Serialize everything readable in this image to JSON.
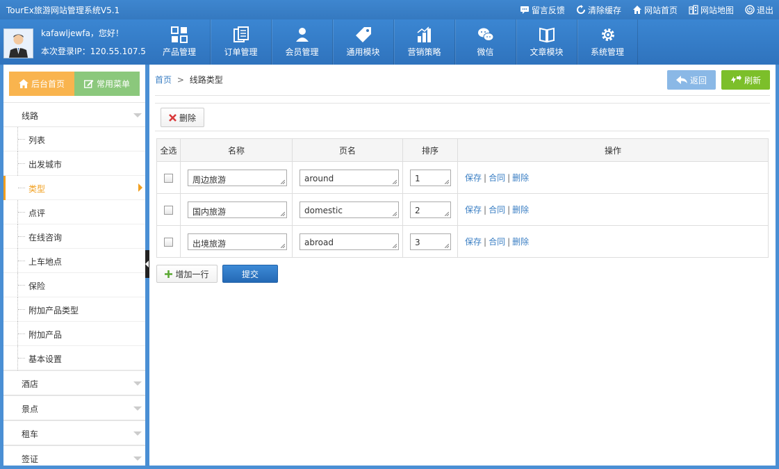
{
  "app": {
    "title": "TourEx旅游网站管理系统V5.1"
  },
  "top_links": [
    {
      "label": "留言反馈",
      "icon": "message-icon"
    },
    {
      "label": "清除缓存",
      "icon": "refresh-cache-icon"
    },
    {
      "label": "网站首页",
      "icon": "home-icon"
    },
    {
      "label": "网站地图",
      "icon": "sitemap-icon"
    },
    {
      "label": "退出",
      "icon": "power-icon"
    }
  ],
  "user": {
    "greeting": "kafawljewfa，您好！",
    "last_login": "本次登录IP：120.55.107.5"
  },
  "nav": [
    {
      "label": "产品管理",
      "icon": "grid-icon"
    },
    {
      "label": "订单管理",
      "icon": "document-icon"
    },
    {
      "label": "会员管理",
      "icon": "user-icon"
    },
    {
      "label": "通用模块",
      "icon": "tag-icon"
    },
    {
      "label": "营销策略",
      "icon": "bar-chart-icon"
    },
    {
      "label": "微信",
      "icon": "wechat-icon"
    },
    {
      "label": "文章模块",
      "icon": "book-icon"
    },
    {
      "label": "系统管理",
      "icon": "gear-icon"
    }
  ],
  "sidebar": {
    "home_button": "后台首页",
    "common_button": "常用菜单",
    "group_route": "线路",
    "items": [
      "列表",
      "出发城市",
      "类型",
      "点评",
      "在线咨询",
      "上车地点",
      "保险",
      "附加产品类型",
      "附加产品",
      "基本设置"
    ],
    "active_index": 2,
    "groups": [
      "酒店",
      "景点",
      "租车",
      "签证"
    ]
  },
  "breadcrumb": {
    "home": "首页",
    "separator": ">",
    "current": "线路类型"
  },
  "toolbar": {
    "back": "返回",
    "refresh": "刷新",
    "delete": "删除"
  },
  "table": {
    "headers": {
      "select_all": "全选",
      "name": "名称",
      "page_name": "页名",
      "sort": "排序",
      "actions": "操作"
    },
    "rows": [
      {
        "name": "周边旅游",
        "page": "around",
        "sort": "1"
      },
      {
        "name": "国内旅游",
        "page": "domestic",
        "sort": "2"
      },
      {
        "name": "出境旅游",
        "page": "abroad",
        "sort": "3"
      }
    ],
    "ops": {
      "save": "保存",
      "merge": "合同",
      "delete": "删除",
      "sep": "|"
    }
  },
  "bottom": {
    "add_row": "增加一行",
    "submit": "提交"
  },
  "colors": {
    "accent_orange": "#f19f1f",
    "header_blue": "#3579c0",
    "refresh_green": "#7cbf2a",
    "back_blue": "#8ab8e6",
    "link_blue": "#3b7fc4"
  }
}
